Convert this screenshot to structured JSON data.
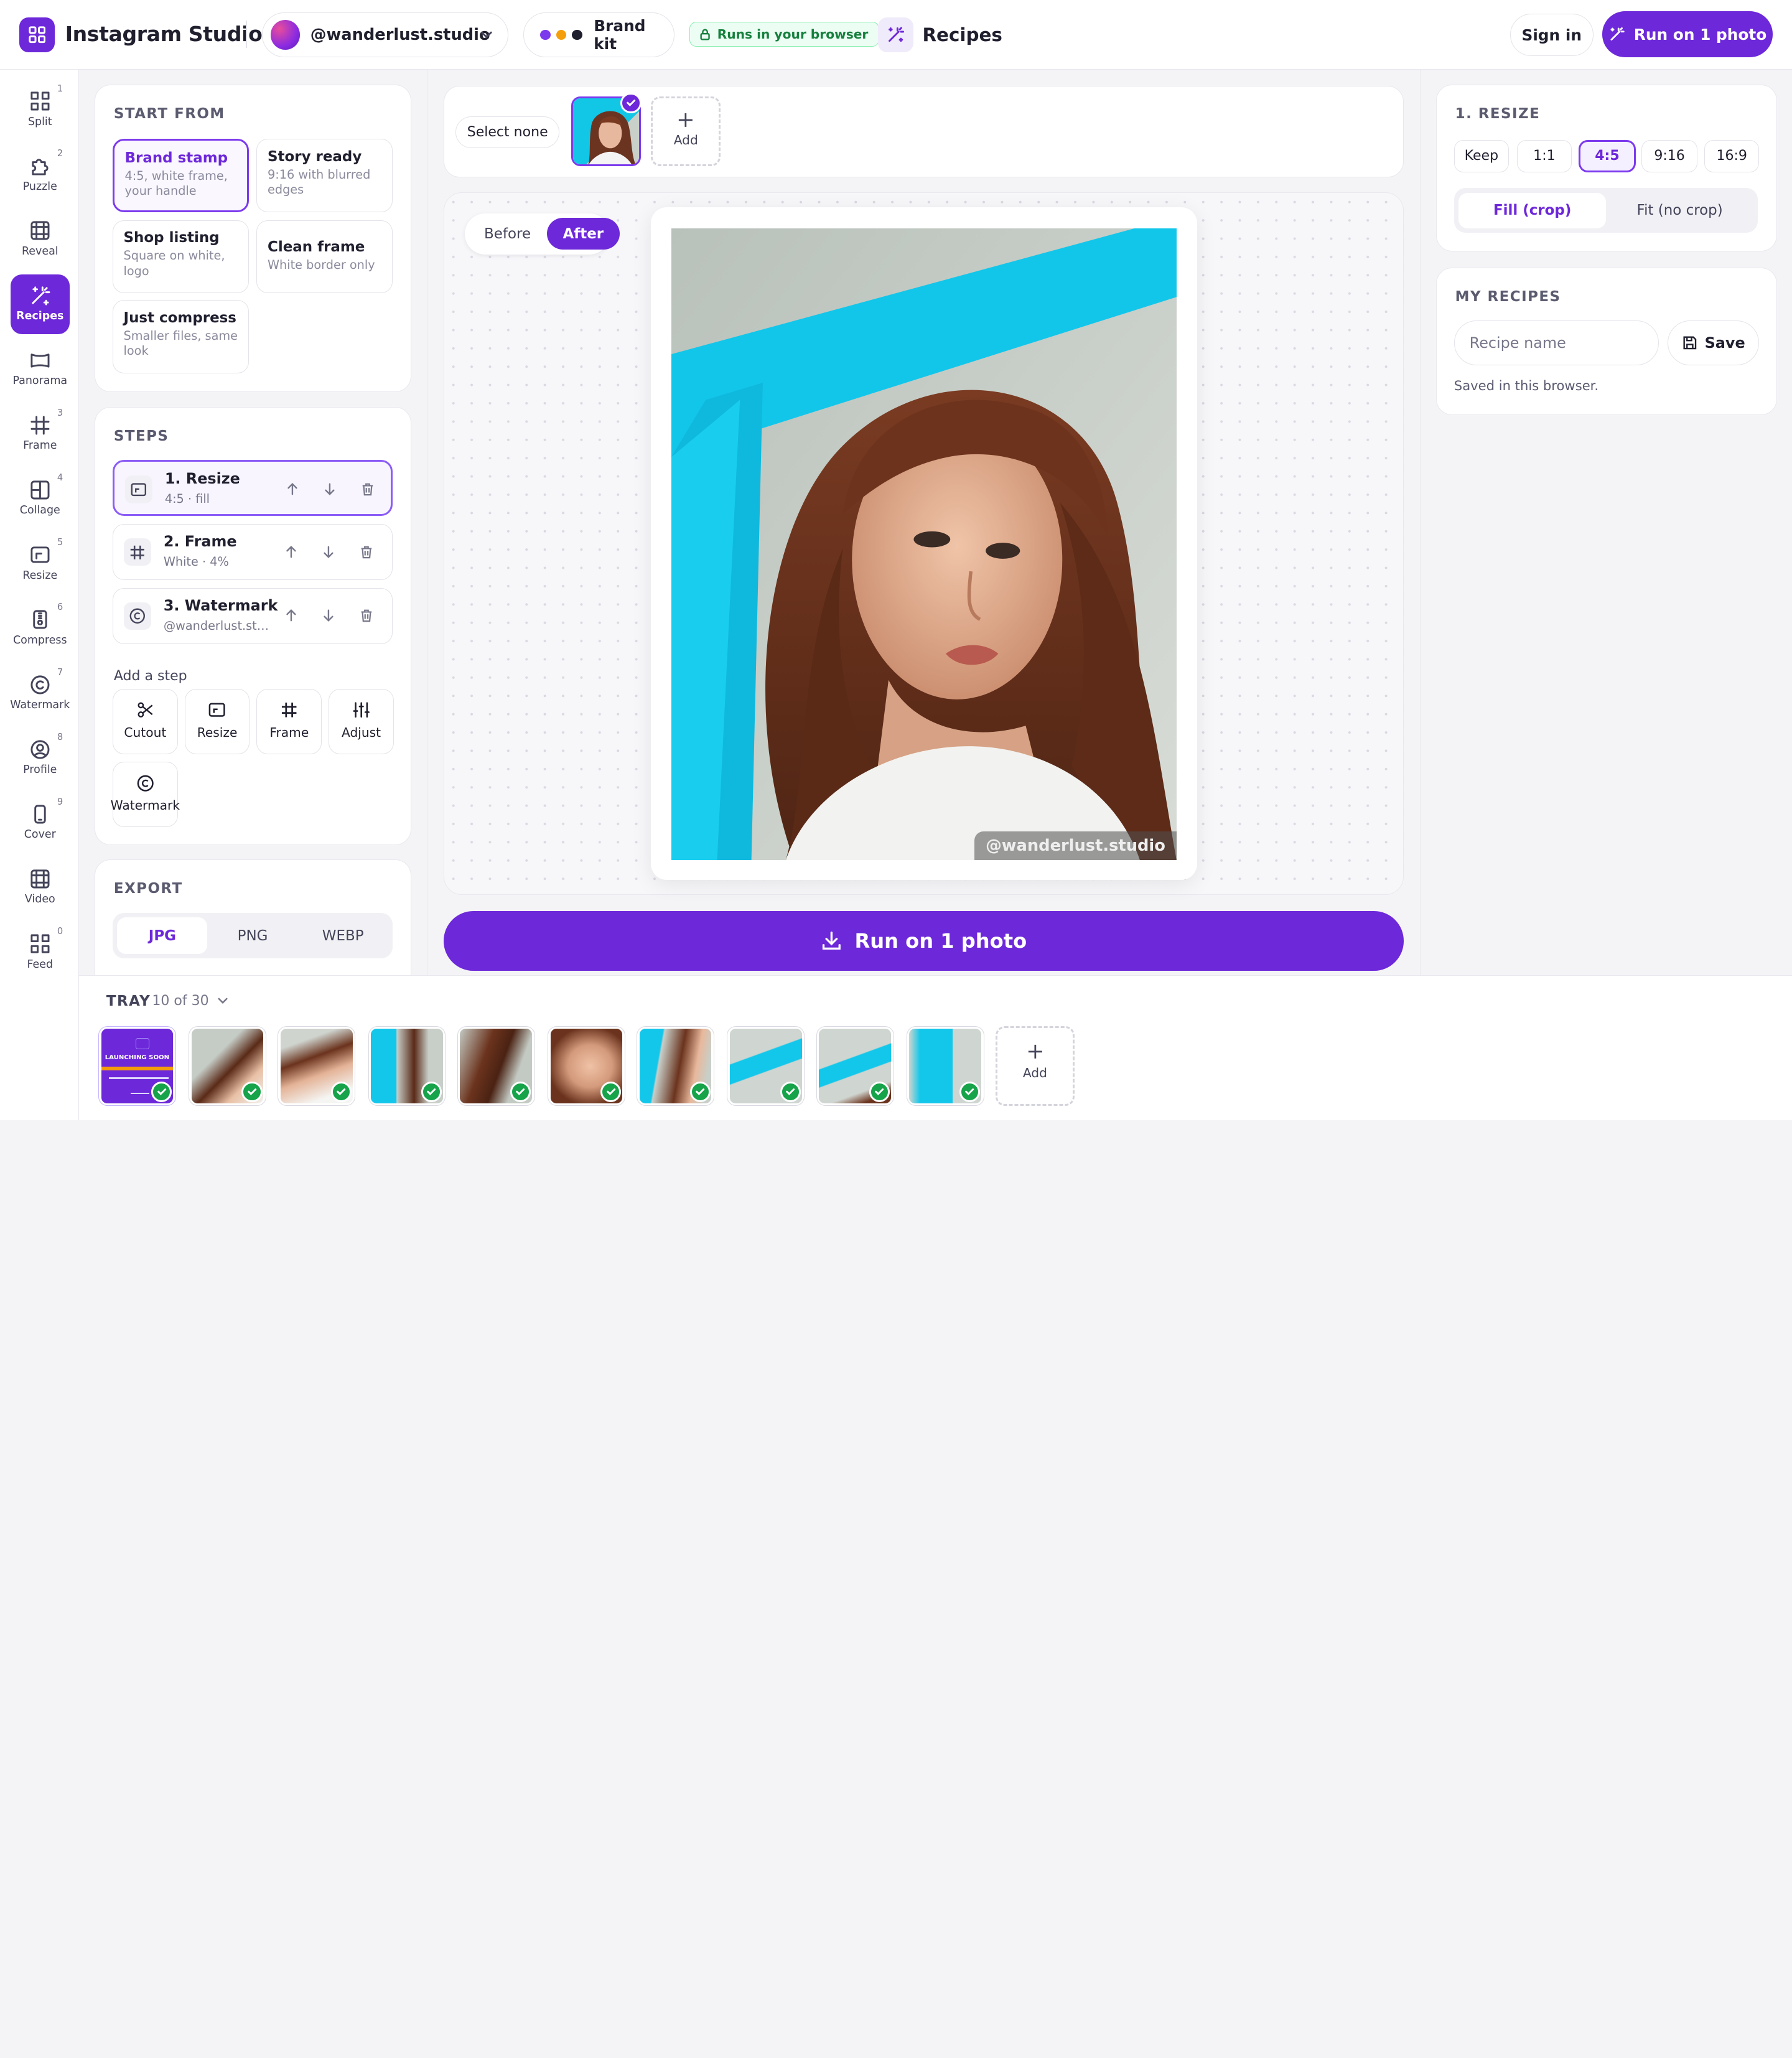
{
  "app": {
    "title": "Instagram Studio",
    "accent": "#6d28d9"
  },
  "header": {
    "account": "@wanderlust.studio",
    "brand_kit": "Brand kit",
    "brand_colors": [
      "#7c3aed",
      "#f59e0b",
      "#1f1f2e"
    ],
    "runs_badge": "Runs in your browser",
    "section": "Recipes",
    "sign_in": "Sign in",
    "run_button": "Run on 1 photo"
  },
  "rail": [
    {
      "label": "Split",
      "num": "1",
      "icon": "grid-icon"
    },
    {
      "label": "Puzzle",
      "num": "2",
      "icon": "puzzle-icon"
    },
    {
      "label": "Reveal",
      "num": "",
      "icon": "film-icon"
    },
    {
      "label": "Recipes",
      "num": "",
      "icon": "magic-wand-icon",
      "active": true
    },
    {
      "label": "Panorama",
      "num": "",
      "icon": "panorama-icon"
    },
    {
      "label": "Frame",
      "num": "3",
      "icon": "hash-frame-icon"
    },
    {
      "label": "Collage",
      "num": "4",
      "icon": "collage-icon"
    },
    {
      "label": "Resize",
      "num": "5",
      "icon": "resize-icon"
    },
    {
      "label": "Compress",
      "num": "6",
      "icon": "zip-file-icon"
    },
    {
      "label": "Watermark",
      "num": "7",
      "icon": "copyright-icon"
    },
    {
      "label": "Profile",
      "num": "8",
      "icon": "profile-icon"
    },
    {
      "label": "Cover",
      "num": "9",
      "icon": "phone-icon"
    },
    {
      "label": "Video",
      "num": "",
      "icon": "film-icon"
    },
    {
      "label": "Feed",
      "num": "0",
      "icon": "grid-icon"
    }
  ],
  "start_from": {
    "title": "START FROM",
    "presets": [
      {
        "title": "Brand stamp",
        "desc": "4:5, white frame, your handle",
        "selected": true
      },
      {
        "title": "Story ready",
        "desc": "9:16 with blurred edges"
      },
      {
        "title": "Shop listing",
        "desc": "Square on white, logo"
      },
      {
        "title": "Clean frame",
        "desc": "White border only"
      },
      {
        "title": "Just compress",
        "desc": "Smaller files, same look"
      }
    ]
  },
  "steps": {
    "title": "STEPS",
    "items": [
      {
        "title": "1. Resize",
        "sub": "4:5 · fill",
        "icon": "resize-icon"
      },
      {
        "title": "2. Frame",
        "sub": "White · 4%",
        "icon": "hash-frame-icon"
      },
      {
        "title": "3. Watermark",
        "sub": "@wanderlust.stu…",
        "icon": "copyright-icon"
      }
    ],
    "add_label": "Add a step",
    "add_buttons": [
      "Cutout",
      "Resize",
      "Frame",
      "Adjust",
      "Watermark"
    ]
  },
  "export": {
    "title": "EXPORT",
    "formats": [
      "JPG",
      "PNG",
      "WEBP"
    ],
    "selected": "JPG"
  },
  "selection": {
    "select_none": "Select none",
    "add": "Add"
  },
  "preview": {
    "before": "Before",
    "after": "After",
    "watermark": "@wanderlust.studio"
  },
  "run_big": "Run on 1 photo",
  "resize_panel": {
    "title": "1. RESIZE",
    "ratios": [
      "Keep",
      "1:1",
      "4:5",
      "9:16",
      "16:9"
    ],
    "selected_ratio": "4:5",
    "modes": [
      "Fill (crop)",
      "Fit (no crop)"
    ],
    "selected_mode": "Fill (crop)"
  },
  "my_recipes": {
    "title": "MY RECIPES",
    "placeholder": "Recipe name",
    "save": "Save",
    "note": "Saved in this browser."
  },
  "tray": {
    "title": "TRAY",
    "count": "10 of 30",
    "add": "Add",
    "thumb_text": "LAUNCHING SOON"
  }
}
